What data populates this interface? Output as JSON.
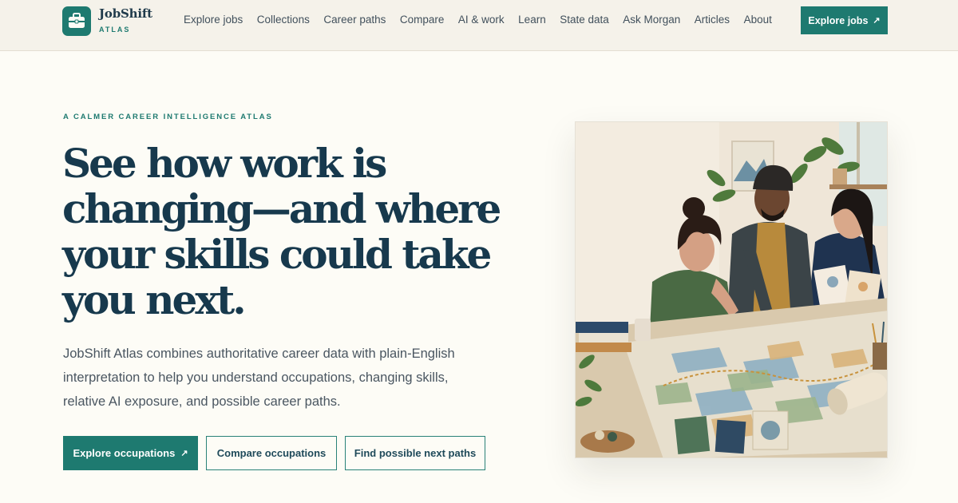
{
  "header": {
    "logo": {
      "name": "JobShift",
      "sub": "ATLAS",
      "icon": "briefcase-icon"
    },
    "nav": [
      "Explore jobs",
      "Collections",
      "Career paths",
      "Compare",
      "AI & work",
      "Learn",
      "State data",
      "Ask Morgan",
      "Articles",
      "About"
    ],
    "cta": {
      "label": "Explore jobs",
      "arrow": "↗"
    }
  },
  "hero": {
    "eyebrow": "A CALMER CAREER INTELLIGENCE ATLAS",
    "title_lines": [
      "See how work is",
      "changing—and where",
      "your skills could take",
      "you next."
    ],
    "body": "JobShift Atlas combines authoritative career data with plain-English interpretation to help you understand occupations, changing skills, relative AI exposure, and possible career paths.",
    "buttons": {
      "primary": {
        "label": "Explore occupations",
        "arrow": "↗"
      },
      "compare": {
        "label": "Compare occupations"
      },
      "paths": {
        "label": "Find possible next paths"
      }
    }
  },
  "colors": {
    "accent": "#1e7a70",
    "heading": "#17394d",
    "background": "#fdfcf6",
    "header_bg": "#f5f2ea"
  }
}
